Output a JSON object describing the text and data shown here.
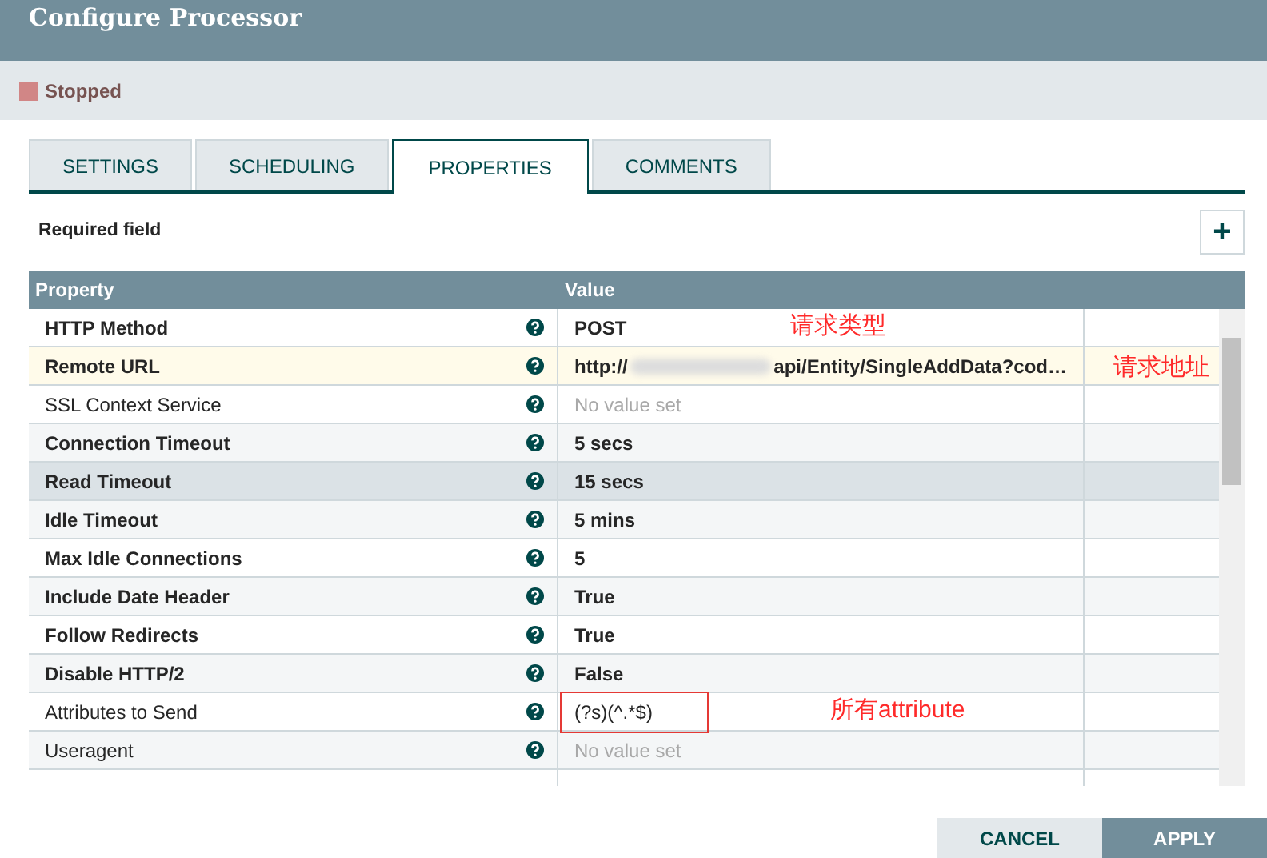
{
  "window": {
    "title": "Configure Processor"
  },
  "status": {
    "label": "Stopped",
    "color": "#d18686"
  },
  "tabs": [
    {
      "label": "SETTINGS",
      "selected": false
    },
    {
      "label": "SCHEDULING",
      "selected": false
    },
    {
      "label": "PROPERTIES",
      "selected": true
    },
    {
      "label": "COMMENTS",
      "selected": false
    }
  ],
  "required_note": "Required field",
  "add_button": "+",
  "table": {
    "columns": [
      "Property",
      "Value"
    ],
    "rows": [
      {
        "name": "HTTP Method",
        "required": true,
        "value": "POST",
        "empty": false,
        "selected": false,
        "highlighted": false,
        "annotation": "请求类型"
      },
      {
        "name": "Remote URL",
        "required": true,
        "value": "http://",
        "value_tail": "api/Entity/SingleAddData?cod…",
        "redacted": true,
        "empty": false,
        "selected": false,
        "highlighted": true,
        "side_note": "请求地址"
      },
      {
        "name": "SSL Context Service",
        "required": false,
        "value": "No value set",
        "empty": true,
        "selected": false,
        "highlighted": false
      },
      {
        "name": "Connection Timeout",
        "required": true,
        "value": "5 secs",
        "empty": false,
        "selected": false,
        "highlighted": false
      },
      {
        "name": "Read Timeout",
        "required": true,
        "value": "15 secs",
        "empty": false,
        "selected": true,
        "highlighted": false
      },
      {
        "name": "Idle Timeout",
        "required": true,
        "value": "5 mins",
        "empty": false,
        "selected": false,
        "highlighted": false
      },
      {
        "name": "Max Idle Connections",
        "required": true,
        "value": "5",
        "empty": false,
        "selected": false,
        "highlighted": false
      },
      {
        "name": "Include Date Header",
        "required": true,
        "value": "True",
        "empty": false,
        "selected": false,
        "highlighted": false
      },
      {
        "name": "Follow Redirects",
        "required": true,
        "value": "True",
        "empty": false,
        "selected": false,
        "highlighted": false
      },
      {
        "name": "Disable HTTP/2",
        "required": true,
        "value": "False",
        "empty": false,
        "selected": false,
        "highlighted": false
      },
      {
        "name": "Attributes to Send",
        "required": false,
        "value": "(?s)(^.*$)",
        "empty": false,
        "selected": false,
        "highlighted": false,
        "boxed": true,
        "annotation": "所有attribute"
      },
      {
        "name": "Useragent",
        "required": false,
        "value": "No value set",
        "empty": true,
        "selected": false,
        "highlighted": false
      }
    ]
  },
  "buttons": [
    {
      "label": "CANCEL",
      "kind": "secondary"
    },
    {
      "label": "APPLY",
      "kind": "primary"
    }
  ]
}
